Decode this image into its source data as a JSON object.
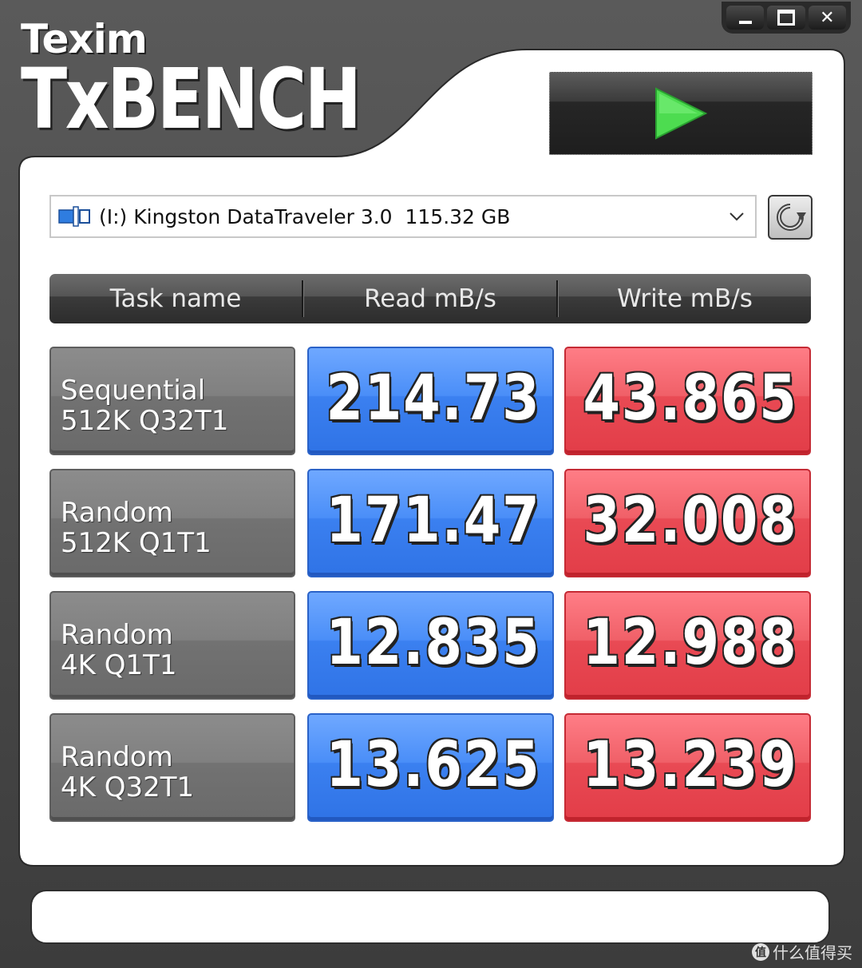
{
  "app": {
    "brand_small": "Texim",
    "brand_big": "TxBENCH"
  },
  "window_controls": {
    "close_label": "✕"
  },
  "drive": {
    "text": "(I:) Kingston DataTraveler 3.0  115.32 GB",
    "icon": "usb-drive-icon"
  },
  "columns": [
    "Task name",
    "Read mB/s",
    "Write mB/s"
  ],
  "results": [
    {
      "name_line1": "Sequential",
      "name_line2": "512K Q32T1",
      "read": "214.73",
      "write": "43.865"
    },
    {
      "name_line1": "Random",
      "name_line2": "512K Q1T1",
      "read": "171.47",
      "write": "32.008"
    },
    {
      "name_line1": "Random",
      "name_line2": "4K Q1T1",
      "read": "12.835",
      "write": "12.988"
    },
    {
      "name_line1": "Random",
      "name_line2": "4K Q32T1",
      "read": "13.625",
      "write": "13.239"
    }
  ],
  "status": {
    "text": ""
  },
  "watermark": {
    "icon_glyph": "值",
    "text": "什么值得买"
  },
  "colors": {
    "read": "#3b80f0",
    "write": "#e94a54",
    "start_arrow": "#4ddc50"
  }
}
